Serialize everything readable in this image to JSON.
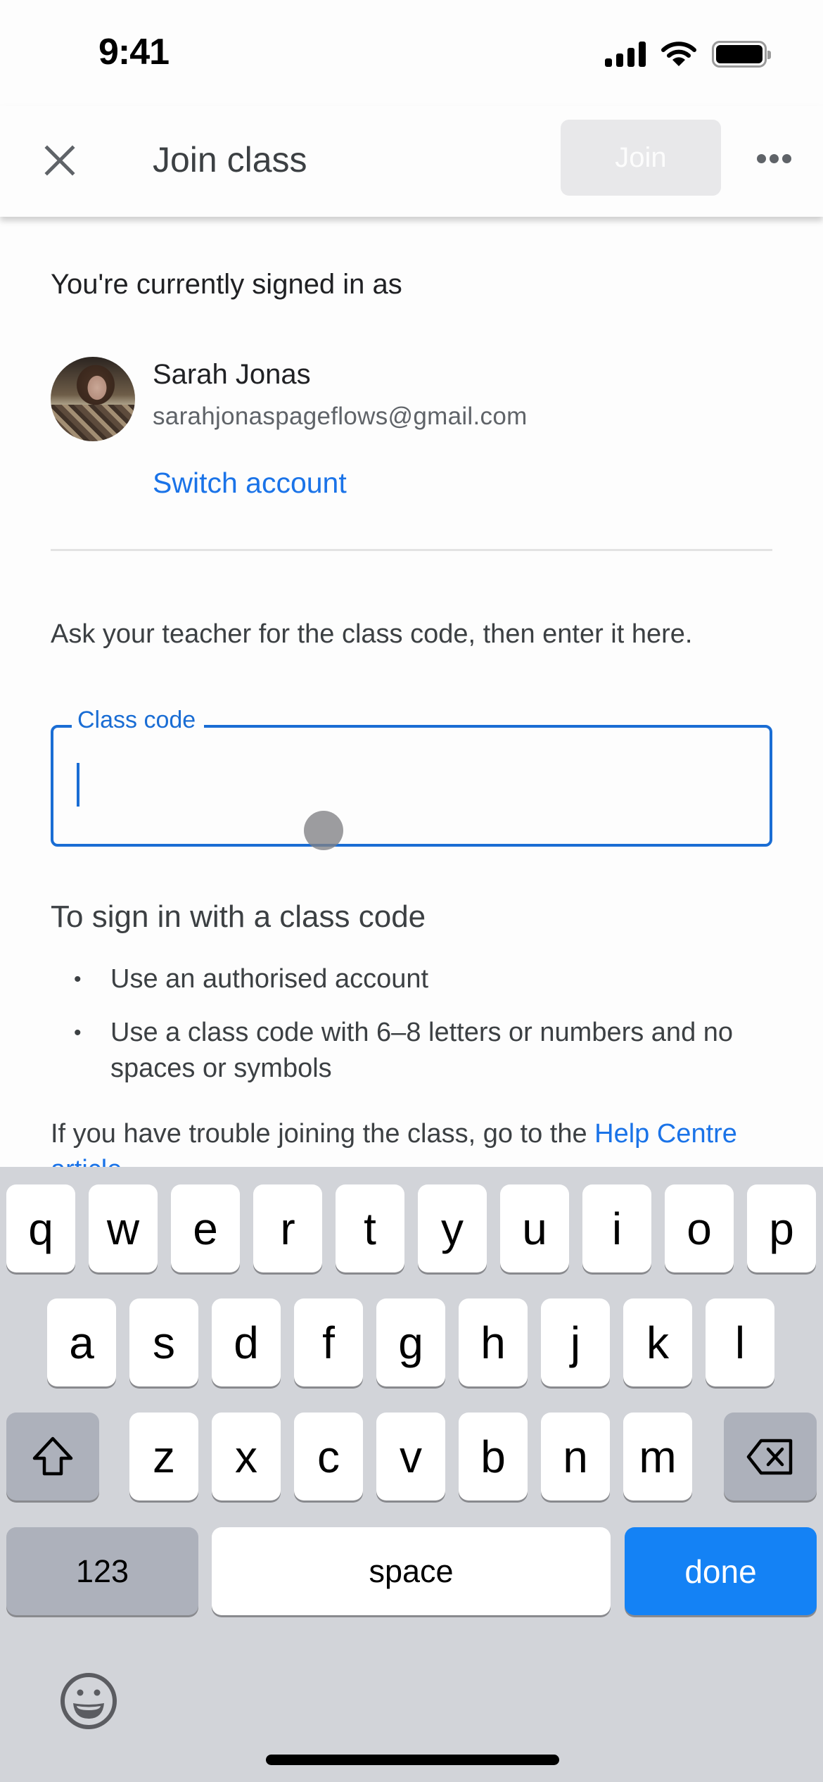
{
  "status_bar": {
    "time": "9:41",
    "icons": [
      "cellular-signal-icon",
      "wifi-icon",
      "battery-icon"
    ]
  },
  "app_bar": {
    "close_icon": "close-icon",
    "title": "Join class",
    "join_label": "Join",
    "join_enabled": false,
    "more_icon": "more-horizontal-icon"
  },
  "account": {
    "signed_in_label": "You're currently signed in as",
    "name": "Sarah Jonas",
    "email": "sarahjonaspageflows@gmail.com",
    "switch_label": "Switch account"
  },
  "class_code": {
    "instructions": "Ask your teacher for the class code, then enter it here.",
    "label": "Class code",
    "value": "",
    "placeholder": ""
  },
  "howto": {
    "heading": "To sign in with a class code",
    "items": [
      "Use an authorised account",
      "Use a class code with 6–8 letters or numbers and no spaces or symbols"
    ],
    "bullet": "•",
    "trouble_text": "If you have trouble joining the class, go to the ",
    "trouble_link": "Help Centre article"
  },
  "keyboard": {
    "row1": [
      "q",
      "w",
      "e",
      "r",
      "t",
      "y",
      "u",
      "i",
      "o",
      "p"
    ],
    "row2": [
      "a",
      "s",
      "d",
      "f",
      "g",
      "h",
      "j",
      "k",
      "l"
    ],
    "row3": [
      "z",
      "x",
      "c",
      "v",
      "b",
      "n",
      "m"
    ],
    "shift_icon": "shift-icon",
    "delete_icon": "backspace-icon",
    "numbers_label": "123",
    "space_label": "space",
    "done_label": "done",
    "emoji_icon": "emoji-icon"
  },
  "colors": {
    "accent": "#1a73e8",
    "field_border": "#1a6dd4",
    "join_disabled_bg": "#e8e8ea",
    "keyboard_bg": "#d2d4d9",
    "done_key": "#1482f5"
  }
}
